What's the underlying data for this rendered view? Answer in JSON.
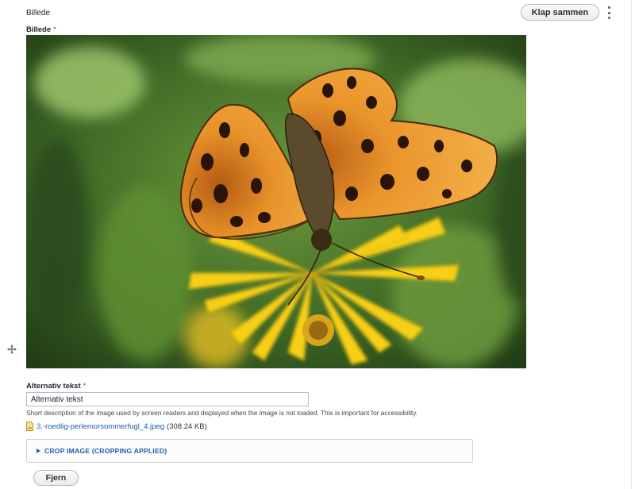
{
  "section": {
    "label": "Billede",
    "collapse_label": "Klap sammen"
  },
  "image_field": {
    "label": "Billede",
    "required_mark": "*"
  },
  "alt_field": {
    "label": "Alternativ tekst",
    "required_mark": "*",
    "value": "Alternativ tekst",
    "description": "Short description of the image used by screen readers and displayed when the image is not loaded. This is important for accessibility."
  },
  "file": {
    "name": "3.-roedlig-perlemorsommerfugl_4.jpeg",
    "size": "(308.24 KB)",
    "icon": "image-file-icon"
  },
  "crop": {
    "summary": "CROP IMAGE (CROPPING APPLIED)"
  },
  "actions": {
    "remove_label": "Fjern"
  },
  "colors": {
    "link": "#1d5fab",
    "required": "#d72222",
    "butterfly_orange": "#e8922a",
    "flower_yellow": "#f6cf16",
    "foliage_green": "#4d7a2d"
  }
}
